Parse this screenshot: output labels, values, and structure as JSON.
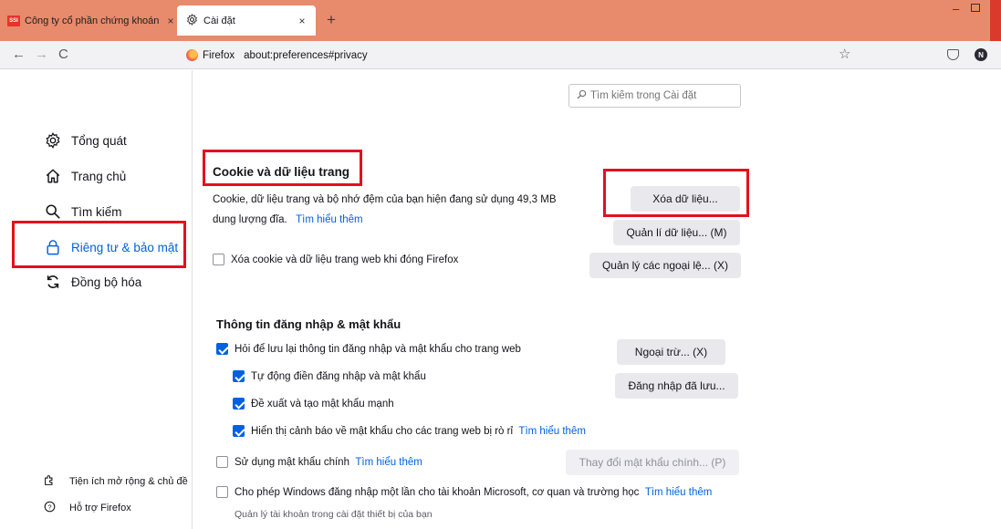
{
  "tabs": [
    {
      "favicon": "SSI",
      "title": "Công ty cổ phần chứng khoán",
      "close": "×"
    },
    {
      "title": "Cài đặt",
      "close": "×"
    }
  ],
  "new_tab": "+",
  "window": {
    "minimize": "–"
  },
  "nav": {
    "back": "←",
    "forward": "→",
    "reload": "C",
    "identity": "Firefox",
    "url": "about:preferences#privacy",
    "account_initial": "N"
  },
  "search": {
    "placeholder": "Tìm kiếm trong Cài đặt"
  },
  "sidebar": {
    "items": [
      {
        "label": "Tổng quát"
      },
      {
        "label": "Trang chủ"
      },
      {
        "label": "Tìm kiếm"
      },
      {
        "label": "Riêng tư & bảo mật",
        "selected": true
      },
      {
        "label": "Đồng bộ hóa"
      }
    ],
    "footer": [
      {
        "label": "Tiện ích mở rộng & chủ đề"
      },
      {
        "label": "Hỗ trợ Firefox"
      }
    ]
  },
  "cookies": {
    "heading": "Cookie và dữ liệu trang",
    "desc_line1": "Cookie, dữ liệu trang và bộ nhớ đệm của bạn hiện đang sử dụng 49,3 MB",
    "desc_line2": "dung lượng đĩa.",
    "learn_more": "Tìm hiểu thêm",
    "clear_button": "Xóa dữ liệu...",
    "manage_button": "Quản lí dữ liệu... (M)",
    "exceptions_button": "Quản lý các ngoại lệ... (X)",
    "delete_on_close": {
      "label": "Xóa cookie và dữ liệu trang web khi đóng Firefox",
      "checked": false
    }
  },
  "logins": {
    "heading": "Thông tin đăng nhập & mật khẩu",
    "ask_save": {
      "label": "Hỏi để lưu lại thông tin đăng nhập và mật khẩu cho trang web",
      "checked": true
    },
    "autofill": {
      "label": "Tự động điền đăng nhập và mật khẩu",
      "checked": true
    },
    "suggest": {
      "label": "Đề xuất và tạo mật khẩu mạnh",
      "checked": true
    },
    "breach": {
      "label": "Hiển thị cảnh báo về mật khẩu cho các trang web bị rò rỉ",
      "checked": true
    },
    "breach_link": "Tìm hiểu thêm",
    "exceptions_button": "Ngoại trừ... (X)",
    "saved_logins_button": "Đăng nhập đã lưu...",
    "primary_password": {
      "label": "Sử dụng mật khẩu chính",
      "checked": false
    },
    "primary_link": "Tìm hiểu thêm",
    "change_primary_button": "Thay đổi mật khẩu chính... (P)",
    "windows_sso": {
      "label": "Cho phép Windows đăng nhập một lần cho tài khoản Microsoft, cơ quan và trường học",
      "checked": false
    },
    "windows_link": "Tìm hiểu thêm",
    "windows_sub": "Quản lý tài khoản trong cài đặt thiết bị của bạn"
  },
  "colors": {
    "accent": "#0061e0",
    "tabstrip": "#e88a6c",
    "highlight": "#e3101e"
  }
}
